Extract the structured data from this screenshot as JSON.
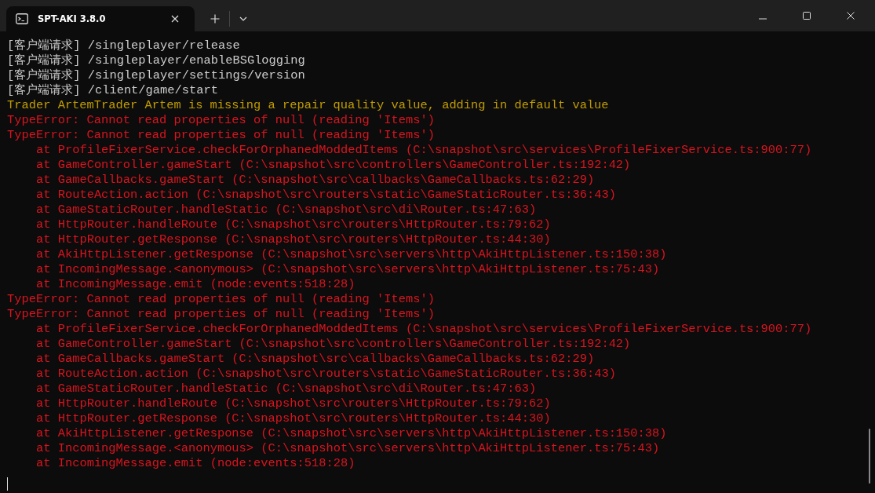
{
  "window": {
    "tab_title": "SPT-AKI 3.8.0"
  },
  "lines": [
    {
      "kind": "request",
      "text": "[客户端请求] /singleplayer/release"
    },
    {
      "kind": "request",
      "text": "[客户端请求] /singleplayer/enableBSGlogging"
    },
    {
      "kind": "request",
      "text": "[客户端请求] /singleplayer/settings/version"
    },
    {
      "kind": "request",
      "text": "[客户端请求] /client/game/start"
    },
    {
      "kind": "warning",
      "text": "Trader ArtemTrader Artem is missing a repair quality value, adding in default value"
    },
    {
      "kind": "error",
      "text": "TypeError: Cannot read properties of null (reading 'Items')"
    },
    {
      "kind": "error",
      "text": "TypeError: Cannot read properties of null (reading 'Items')"
    },
    {
      "kind": "trace",
      "text": "at ProfileFixerService.checkForOrphanedModdedItems (C:\\snapshot\\src\\services\\ProfileFixerService.ts:900:77)"
    },
    {
      "kind": "trace",
      "text": "at GameController.gameStart (C:\\snapshot\\src\\controllers\\GameController.ts:192:42)"
    },
    {
      "kind": "trace",
      "text": "at GameCallbacks.gameStart (C:\\snapshot\\src\\callbacks\\GameCallbacks.ts:62:29)"
    },
    {
      "kind": "trace",
      "text": "at RouteAction.action (C:\\snapshot\\src\\routers\\static\\GameStaticRouter.ts:36:43)"
    },
    {
      "kind": "trace",
      "text": "at GameStaticRouter.handleStatic (C:\\snapshot\\src\\di\\Router.ts:47:63)"
    },
    {
      "kind": "trace",
      "text": "at HttpRouter.handleRoute (C:\\snapshot\\src\\routers\\HttpRouter.ts:79:62)"
    },
    {
      "kind": "trace",
      "text": "at HttpRouter.getResponse (C:\\snapshot\\src\\routers\\HttpRouter.ts:44:30)"
    },
    {
      "kind": "trace",
      "text": "at AkiHttpListener.getResponse (C:\\snapshot\\src\\servers\\http\\AkiHttpListener.ts:150:38)"
    },
    {
      "kind": "trace",
      "text": "at IncomingMessage.<anonymous> (C:\\snapshot\\src\\servers\\http\\AkiHttpListener.ts:75:43)"
    },
    {
      "kind": "trace",
      "text": "at IncomingMessage.emit (node:events:518:28)"
    },
    {
      "kind": "error",
      "text": "TypeError: Cannot read properties of null (reading 'Items')"
    },
    {
      "kind": "error",
      "text": "TypeError: Cannot read properties of null (reading 'Items')"
    },
    {
      "kind": "trace",
      "text": "at ProfileFixerService.checkForOrphanedModdedItems (C:\\snapshot\\src\\services\\ProfileFixerService.ts:900:77)"
    },
    {
      "kind": "trace",
      "text": "at GameController.gameStart (C:\\snapshot\\src\\controllers\\GameController.ts:192:42)"
    },
    {
      "kind": "trace",
      "text": "at GameCallbacks.gameStart (C:\\snapshot\\src\\callbacks\\GameCallbacks.ts:62:29)"
    },
    {
      "kind": "trace",
      "text": "at RouteAction.action (C:\\snapshot\\src\\routers\\static\\GameStaticRouter.ts:36:43)"
    },
    {
      "kind": "trace",
      "text": "at GameStaticRouter.handleStatic (C:\\snapshot\\src\\di\\Router.ts:47:63)"
    },
    {
      "kind": "trace",
      "text": "at HttpRouter.handleRoute (C:\\snapshot\\src\\routers\\HttpRouter.ts:79:62)"
    },
    {
      "kind": "trace",
      "text": "at HttpRouter.getResponse (C:\\snapshot\\src\\routers\\HttpRouter.ts:44:30)"
    },
    {
      "kind": "trace",
      "text": "at AkiHttpListener.getResponse (C:\\snapshot\\src\\servers\\http\\AkiHttpListener.ts:150:38)"
    },
    {
      "kind": "trace",
      "text": "at IncomingMessage.<anonymous> (C:\\snapshot\\src\\servers\\http\\AkiHttpListener.ts:75:43)"
    },
    {
      "kind": "trace",
      "text": "at IncomingMessage.emit (node:events:518:28)"
    }
  ]
}
